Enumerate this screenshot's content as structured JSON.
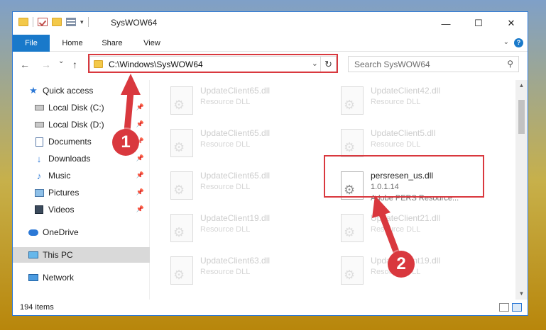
{
  "window": {
    "title": "SysWOW64",
    "controls": {
      "minimize": "—",
      "maximize": "☐",
      "close": "✕"
    }
  },
  "ribbon": {
    "tabs": [
      {
        "label": "File"
      },
      {
        "label": "Home"
      },
      {
        "label": "Share"
      },
      {
        "label": "View"
      }
    ],
    "help": "?"
  },
  "nav": {
    "back": "←",
    "forward": "→",
    "recent": "⌄",
    "up": "↑",
    "address": "C:\\Windows\\SysWOW64",
    "refresh": "↻",
    "search_placeholder": "Search SysWOW64"
  },
  "sidebar": {
    "items": [
      {
        "label": "Quick access",
        "icon": "star-icon"
      },
      {
        "label": "Local Disk (C:)",
        "icon": "drive-icon",
        "pinned": true
      },
      {
        "label": "Local Disk (D:)",
        "icon": "drive-icon",
        "pinned": true
      },
      {
        "label": "Documents",
        "icon": "documents-icon",
        "pinned": true
      },
      {
        "label": "Downloads",
        "icon": "downloads-icon",
        "pinned": true
      },
      {
        "label": "Music",
        "icon": "music-icon",
        "pinned": true
      },
      {
        "label": "Pictures",
        "icon": "pictures-icon",
        "pinned": true
      },
      {
        "label": "Videos",
        "icon": "videos-icon",
        "pinned": true
      },
      {
        "label": "OneDrive",
        "icon": "cloud-icon"
      },
      {
        "label": "This PC",
        "icon": "computer-icon",
        "selected": true
      },
      {
        "label": "Network",
        "icon": "network-icon"
      }
    ]
  },
  "files": {
    "left": [
      {
        "name": "UpdateClient65.dll",
        "type": "Resource DLL"
      },
      {
        "name": "UpdateClient65.dll",
        "type": "Resource DLL"
      },
      {
        "name": "UpdateClient65.dll",
        "type": "Resource DLL"
      },
      {
        "name": "UpdateClient19.dll",
        "type": "Resource DLL"
      },
      {
        "name": "UpdateClient63.dll",
        "type": "Resource DLL"
      }
    ],
    "right": [
      {
        "name": "UpdateClient42.dll",
        "type": "Resource DLL"
      },
      {
        "name": "UpdateClient5.dll",
        "type": "Resource DLL"
      },
      {
        "name": "persresen_us.dll",
        "version": "1.0.1.14",
        "type": "Adobe PERS Resource...",
        "highlighted": true
      },
      {
        "name": "UpdateClient21.dll",
        "type": "Resource DLL"
      },
      {
        "name": "UpdateClient19.dll",
        "type": "Resource DLL"
      }
    ]
  },
  "status": {
    "count": "194 items"
  },
  "annotations": {
    "step1": "1",
    "step2": "2",
    "accent": "#d9383e"
  }
}
